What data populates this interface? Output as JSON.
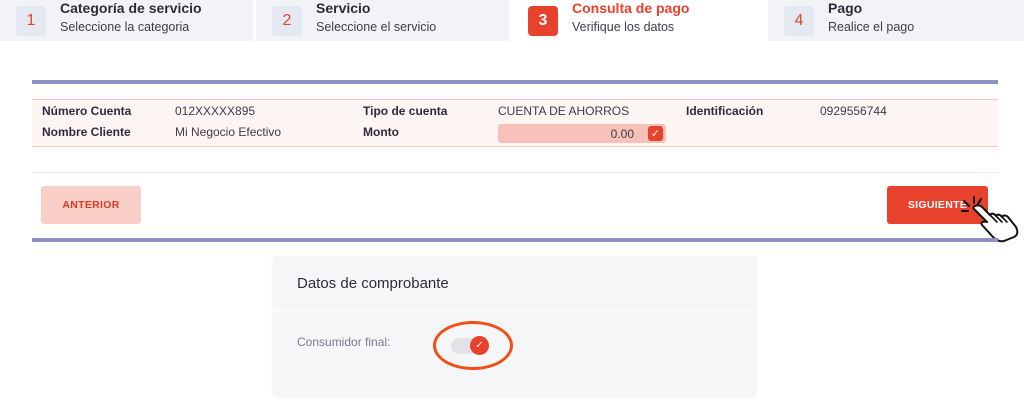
{
  "stepper": {
    "steps": [
      {
        "number": "1",
        "title": "Categoría de servicio",
        "subtitle": "Seleccione la categoria"
      },
      {
        "number": "2",
        "title": "Servicio",
        "subtitle": "Seleccione el servicio"
      },
      {
        "number": "3",
        "title": "Consulta de pago",
        "subtitle": "Verifique los datos"
      },
      {
        "number": "4",
        "title": "Pago",
        "subtitle": "Realice el pago"
      }
    ],
    "active_step": 3
  },
  "summary": {
    "numero_cuenta_label": "Número Cuenta",
    "numero_cuenta_value": "012XXXXX895",
    "tipo_cuenta_label": "Tipo de cuenta",
    "tipo_cuenta_value": "CUENTA DE AHORROS",
    "identificacion_label": "Identificación",
    "identificacion_value": "0929556744",
    "nombre_cliente_label": "Nombre Cliente",
    "nombre_cliente_value": "Mi Negocio Efectivo",
    "monto_label": "Monto",
    "monto_value": "0.00"
  },
  "actions": {
    "prev_label": "ANTERIOR",
    "next_label": "SIGUIENTE"
  },
  "voucher": {
    "title": "Datos de comprobante",
    "consumidor_label": "Consumidor final:",
    "consumidor_enabled": true
  },
  "colors": {
    "accent": "#e8412c",
    "rule": "#8f8fc4",
    "highlight": "#f24e16"
  }
}
